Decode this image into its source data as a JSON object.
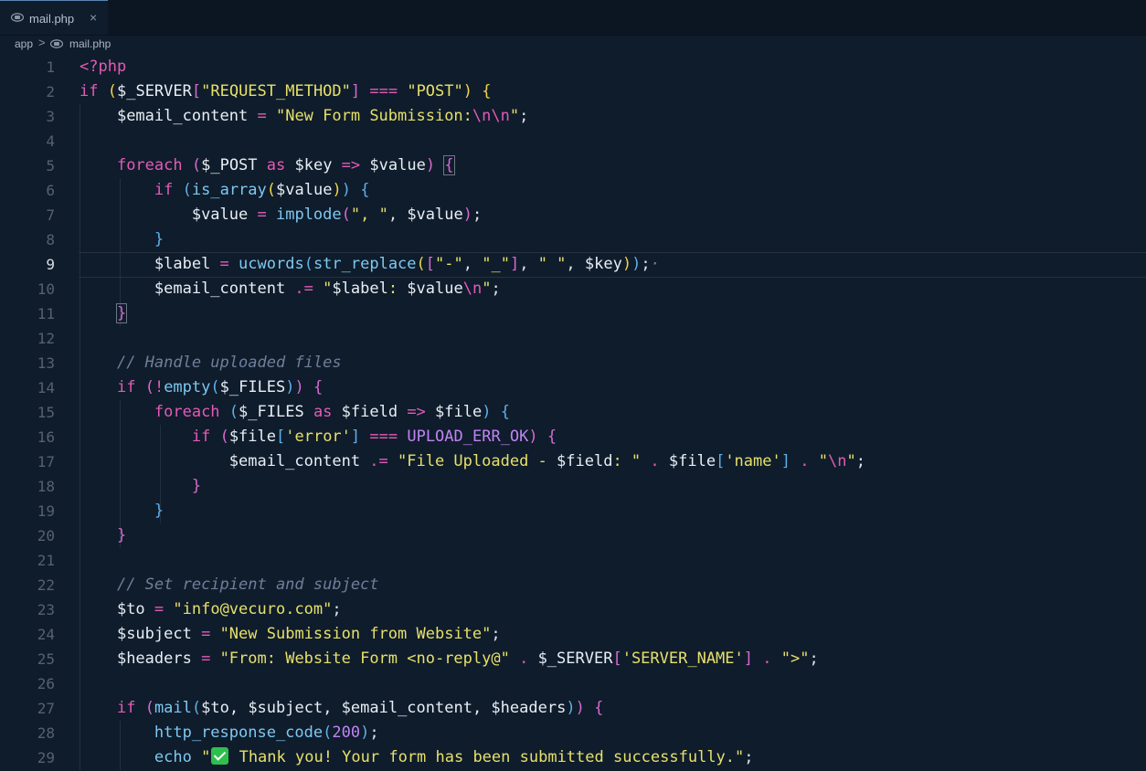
{
  "tabs": [
    {
      "label": "mail.php",
      "close": "×",
      "icon": "php-file-icon"
    }
  ],
  "breadcrumb": {
    "root": "app",
    "separator": ">",
    "file": "mail.php",
    "file_icon": "php-file-icon"
  },
  "editor": {
    "current_line": 9,
    "line_numbers": [
      "1",
      "2",
      "3",
      "4",
      "5",
      "6",
      "7",
      "8",
      "9",
      "10",
      "11",
      "12",
      "13",
      "14",
      "15",
      "16",
      "17",
      "18",
      "19",
      "20",
      "21",
      "22",
      "23",
      "24",
      "25",
      "26",
      "27",
      "28",
      "29"
    ],
    "code": {
      "l1": {
        "open": "<?php"
      },
      "l2": {
        "kw": "if",
        "sp": " ",
        "lp": "(",
        "var": "$_SERVER",
        "lb": "[",
        "str": "\"REQUEST_METHOD\"",
        "rb": "]",
        "op": " === ",
        "str2": "\"POST\"",
        "rp": ")",
        "sp2": " ",
        "brace": "{"
      },
      "l3": {
        "indent": "    ",
        "var": "$email_content",
        "op": " = ",
        "str": "\"New Form Submission:",
        "esc": "\\n\\n",
        "strend": "\"",
        "semi": ";"
      },
      "l5": {
        "indent": "    ",
        "kw": "foreach",
        "sp": " ",
        "lp": "(",
        "var1": "$_POST",
        "as": " as ",
        "var2": "$key",
        "arrow": " => ",
        "var3": "$value",
        "rp": ")",
        "sp2": " ",
        "brace": "{"
      },
      "l6": {
        "indent": "        ",
        "kw": "if",
        "sp": " ",
        "lp": "(",
        "fn": "is_array",
        "lp2": "(",
        "var": "$value",
        "rp2": ")",
        "rp": ")",
        "sp2": " ",
        "brace": "{"
      },
      "l7": {
        "indent": "            ",
        "var": "$value",
        "op": " = ",
        "fn": "implode",
        "lp": "(",
        "str": "\", \"",
        "comma": ", ",
        "var2": "$value",
        "rp": ")",
        "semi": ";"
      },
      "l8": {
        "indent": "        ",
        "brace": "}"
      },
      "l9": {
        "indent": "        ",
        "var": "$label",
        "op": " = ",
        "fn": "ucwords",
        "lp": "(",
        "fn2": "str_replace",
        "lp2": "(",
        "lb": "[",
        "str1": "\"-\"",
        "comma1": ", ",
        "str2": "\"_\"",
        "rb": "]",
        "comma2": ", ",
        "str3": "\" \"",
        "comma3": ", ",
        "var2": "$key",
        "rp2": ")",
        "rp": ")",
        "semi": ";",
        "cursor": "·"
      },
      "l10": {
        "indent": "        ",
        "var": "$email_content",
        "op": " .= ",
        "strA": "\"",
        "var2": "$label",
        "strB": ": ",
        "var3": "$value",
        "esc": "\\n",
        "strC": "\"",
        "semi": ";"
      },
      "l11": {
        "indent": "    ",
        "brace": "}"
      },
      "l13": {
        "indent": "    ",
        "comment": "// Handle uploaded files"
      },
      "l14": {
        "indent": "    ",
        "kw": "if",
        "sp": " ",
        "lp": "(",
        "not": "!",
        "fn": "empty",
        "lp2": "(",
        "var": "$_FILES",
        "rp2": ")",
        "rp": ")",
        "sp2": " ",
        "brace": "{"
      },
      "l15": {
        "indent": "        ",
        "kw": "foreach",
        "sp": " ",
        "lp": "(",
        "var1": "$_FILES",
        "as": " as ",
        "var2": "$field",
        "arrow": " => ",
        "var3": "$file",
        "rp": ")",
        "sp2": " ",
        "brace": "{"
      },
      "l16": {
        "indent": "            ",
        "kw": "if",
        "sp": " ",
        "lp": "(",
        "var": "$file",
        "lb": "[",
        "str": "'error'",
        "rb": "]",
        "op": " === ",
        "const": "UPLOAD_ERR_OK",
        "rp": ")",
        "sp2": " ",
        "brace": "{"
      },
      "l17": {
        "indent": "                ",
        "var": "$email_content",
        "op": " .= ",
        "strA": "\"File Uploaded - ",
        "var2": "$field",
        "strB": ": \"",
        "dot1": " . ",
        "var3": "$file",
        "lb": "[",
        "str": "'name'",
        "rb": "]",
        "dot2": " . ",
        "strC": "\"",
        "esc": "\\n",
        "strD": "\"",
        "semi": ";"
      },
      "l18": {
        "indent": "            ",
        "brace": "}"
      },
      "l19": {
        "indent": "        ",
        "brace": "}"
      },
      "l20": {
        "indent": "    ",
        "brace": "}"
      },
      "l22": {
        "indent": "    ",
        "comment": "// Set recipient and subject"
      },
      "l23": {
        "indent": "    ",
        "var": "$to",
        "op": " = ",
        "str": "\"info@vecuro.com\"",
        "semi": ";"
      },
      "l24": {
        "indent": "    ",
        "var": "$subject",
        "op": " = ",
        "str": "\"New Submission from Website\"",
        "semi": ";"
      },
      "l25": {
        "indent": "    ",
        "var": "$headers",
        "op": " = ",
        "str": "\"From: Website Form <no-reply@\"",
        "dot1": " . ",
        "var2": "$_SERVER",
        "lb": "[",
        "str2": "'SERVER_NAME'",
        "rb": "]",
        "dot2": " . ",
        "str3": "\">\"",
        "semi": ";"
      },
      "l27": {
        "indent": "    ",
        "kw": "if",
        "sp": " ",
        "lp": "(",
        "fn": "mail",
        "lp2": "(",
        "args": "$to, $subject, $email_content, $headers",
        "rp2": ")",
        "rp": ")",
        "sp2": " ",
        "brace": "{"
      },
      "l28": {
        "indent": "        ",
        "fn": "http_response_code",
        "lp": "(",
        "num": "200",
        "rp": ")",
        "semi": ";"
      },
      "l29": {
        "indent": "        ",
        "kw": "echo",
        "sp": " ",
        "strA": "\"",
        "emoji": "check-mark-emoji-icon",
        "strB": " Thank you! Your form has been submitted successfully.\"",
        "semi": ";"
      }
    }
  }
}
